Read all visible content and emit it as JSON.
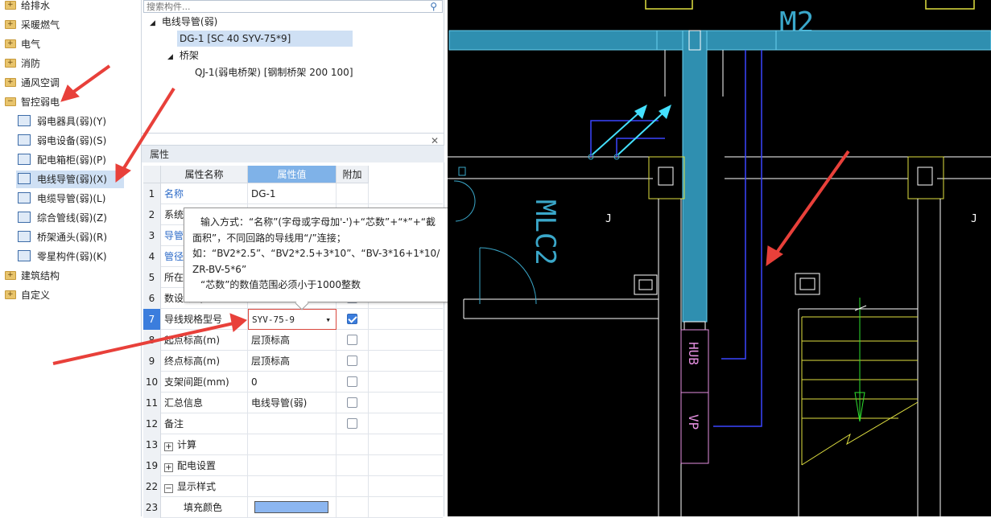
{
  "left_tree": {
    "items": [
      {
        "label": "给排水",
        "kind": "folder"
      },
      {
        "label": "采暖燃气",
        "kind": "folder"
      },
      {
        "label": "电气",
        "kind": "folder"
      },
      {
        "label": "消防",
        "kind": "folder"
      },
      {
        "label": "通风空调",
        "kind": "folder"
      },
      {
        "label": "智控弱电",
        "kind": "folder-open"
      },
      {
        "label": "弱电器具(弱)(Y)",
        "kind": "child"
      },
      {
        "label": "弱电设备(弱)(S)",
        "kind": "child"
      },
      {
        "label": "配电箱柜(弱)(P)",
        "kind": "child"
      },
      {
        "label": "电线导管(弱)(X)",
        "kind": "child",
        "selected": true
      },
      {
        "label": "电缆导管(弱)(L)",
        "kind": "child"
      },
      {
        "label": "综合管线(弱)(Z)",
        "kind": "child"
      },
      {
        "label": "桥架通头(弱)(R)",
        "kind": "child"
      },
      {
        "label": "零星构件(弱)(K)",
        "kind": "child"
      },
      {
        "label": "建筑结构",
        "kind": "folder"
      },
      {
        "label": "自定义",
        "kind": "folder"
      }
    ]
  },
  "component_panel": {
    "search_placeholder": "搜索构件...",
    "group1": "电线导管(弱)",
    "item1": "DG-1 [SC 40 SYV-75*9]",
    "group2": "桥架",
    "item2": "QJ-1(弱电桥架) [钢制桥架 200 100]"
  },
  "properties": {
    "title": "属性",
    "columns": {
      "name": "属性名称",
      "value": "属性值",
      "add": "附加"
    },
    "rows": [
      {
        "num": "1",
        "name": "名称",
        "value": "DG-1",
        "blue": true,
        "check": null
      },
      {
        "num": "2",
        "name": "系统",
        "value": "",
        "blue": false,
        "check": null
      },
      {
        "num": "3",
        "name": "导管",
        "value": "",
        "blue": true,
        "check": null
      },
      {
        "num": "4",
        "name": "管径",
        "value": "",
        "blue": true,
        "check": null
      },
      {
        "num": "5",
        "name": "所在",
        "value": "",
        "blue": false,
        "check": null
      },
      {
        "num": "6",
        "name": "数设方式",
        "value": "",
        "blue": false,
        "check": false
      },
      {
        "num": "7",
        "name": "导线规格型号",
        "value": "SYV-75-9",
        "blue": false,
        "check": true
      },
      {
        "num": "8",
        "name": "起点标高(m)",
        "value": "层顶标高",
        "blue": false,
        "check": false
      },
      {
        "num": "9",
        "name": "终点标高(m)",
        "value": "层顶标高",
        "blue": false,
        "check": false
      },
      {
        "num": "10",
        "name": "支架间距(mm)",
        "value": "0",
        "blue": false,
        "check": false
      },
      {
        "num": "11",
        "name": "汇总信息",
        "value": "电线导管(弱)",
        "blue": false,
        "check": false
      },
      {
        "num": "12",
        "name": "备注",
        "value": "",
        "blue": false,
        "check": false
      },
      {
        "num": "13",
        "name": "计算",
        "value": "",
        "blue": false,
        "check": null,
        "expand": "+"
      },
      {
        "num": "19",
        "name": "配电设置",
        "value": "",
        "blue": false,
        "check": null,
        "expand": "+"
      },
      {
        "num": "22",
        "name": "显示样式",
        "value": "",
        "blue": false,
        "check": null,
        "expand": "−"
      },
      {
        "num": "23",
        "name": "填充颜色",
        "value": "",
        "blue": false,
        "check": null,
        "swatch": true
      }
    ]
  },
  "tooltip": {
    "line1": "输入方式：“名称”(字母或字母加'-')+“芯数”+“*”+“截",
    "line2": "面积”，不同回路的导线用“/”连接；",
    "line3": "如：“BV2*2.5”、“BV2*2.5+3*10”、“BV-3*16+1*10/",
    "line4": "ZR-BV-5*6”",
    "line5": "“芯数”的数值范围必须小于1000整数"
  },
  "cad": {
    "label_m2": "M2",
    "label_mlc2": "MLC2",
    "label_hub": "HUB",
    "label_vp": "VP",
    "colors": {
      "duct": "#3aa7c9",
      "wall": "#ffffff",
      "yellow": "#e0e040",
      "pink": "#e58fe0",
      "blue": "#3a46ff"
    }
  },
  "colors": {
    "accent": "#3b7ddd",
    "selected": "#cfe0f4",
    "header_sel": "#7fb2e8",
    "arrow": "#e8403a",
    "swatch": "#8cb6f0"
  }
}
